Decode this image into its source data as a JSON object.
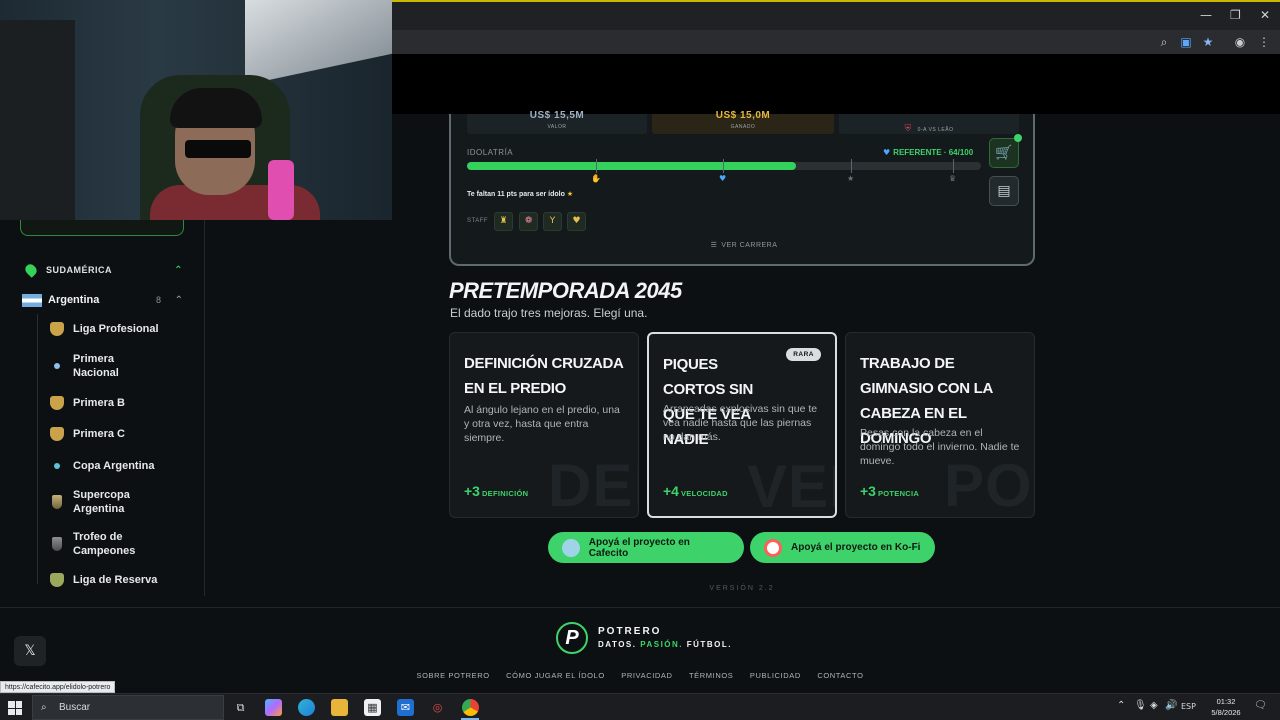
{
  "browser": {
    "window_controls": {
      "minimize": "—",
      "restore": "❐",
      "close": "✕"
    },
    "toolbar_icons": [
      "zoom-icon",
      "extension-icon",
      "bookmark-star-icon",
      "profile-icon",
      "menu-icon"
    ]
  },
  "sidebar": {
    "region": "SUDAMÉRICA",
    "country": {
      "name": "Argentina",
      "count": "8"
    },
    "items": [
      {
        "label": "Liga Profesional",
        "icon": "shield"
      },
      {
        "label": "Primera\nNacional",
        "icon": "dot"
      },
      {
        "label": "Primera B",
        "icon": "shield"
      },
      {
        "label": "Primera C",
        "icon": "shield"
      },
      {
        "label": "Copa Argentina",
        "icon": "dot"
      },
      {
        "label": "Supercopa\nArgentina",
        "icon": "cup"
      },
      {
        "label": "Trofeo de\nCampeones",
        "icon": "cup"
      },
      {
        "label": "Liga de Reserva",
        "icon": "shield"
      }
    ]
  },
  "profile_card": {
    "stats": [
      {
        "value": "US$ 15,5M",
        "label": "VALOR"
      },
      {
        "value": "US$ 15,0M",
        "label": "GANADO"
      },
      {
        "value": "",
        "label": "0-A VS LEÃO"
      }
    ],
    "idolatria_label": "IDOLATRÍA",
    "idolatria_status": "REFERENTE · 64/100",
    "idolatria_value": 64,
    "idolatria_max": 100,
    "points_message": "Te faltan 11 pts para ser ídolo",
    "staff_label": "STAFF",
    "career_link": "VER CARRERA"
  },
  "pretemporada": {
    "title": "PRETEMPORADA 2045",
    "subtitle": "El dado trajo tres mejoras. Elegí una.",
    "cards": [
      {
        "title": "DEFINICIÓN CRUZADA EN EL PREDIO",
        "description": "Al ángulo lejano en el predio, una y otra vez, hasta que entra siempre.",
        "bonus": "+3",
        "stat": "DEFINICIÓN",
        "watermark": "DEF",
        "badge": "",
        "selected": false
      },
      {
        "title": "PIQUES CORTOS SIN QUE TE VEA NADIE",
        "description": "Arrancadas explosivas sin que te vea nadie hasta que las piernas no dan más.",
        "bonus": "+4",
        "stat": "VELOCIDAD",
        "watermark": "VEL",
        "badge": "RARA",
        "selected": true
      },
      {
        "title": "TRABAJO DE GIMNASIO CON LA CABEZA EN EL DOMINGO",
        "description": "Pesas con la cabeza en el domingo todo el invierno. Nadie te mueve.",
        "bonus": "+3",
        "stat": "POTENCIA",
        "watermark": "POT",
        "badge": "",
        "selected": false
      }
    ]
  },
  "support": {
    "cafecito": "Apoyá el proyecto en Cafecito",
    "kofi": "Apoyá el proyecto en Ko-Fi"
  },
  "version": "VERSIÓN 2.2",
  "footer": {
    "brand": "POTRERO",
    "tagline": [
      "DATOS.",
      "PASIÓN.",
      "FÚTBOL."
    ],
    "links": [
      "SOBRE POTRERO",
      "CÓMO JUGAR EL ÍDOLO",
      "PRIVACIDAD",
      "TÉRMINOS",
      "PUBLICIDAD",
      "CONTACTO"
    ]
  },
  "status_url": "https://cafecito.app/elidolo-potrero",
  "taskbar": {
    "search_placeholder": "Buscar",
    "language": "ESP",
    "time": "01:32",
    "date": "5/8/2026"
  },
  "colors": {
    "accent": "#3ed36a",
    "background": "#0d1012",
    "card": "#15191c"
  }
}
